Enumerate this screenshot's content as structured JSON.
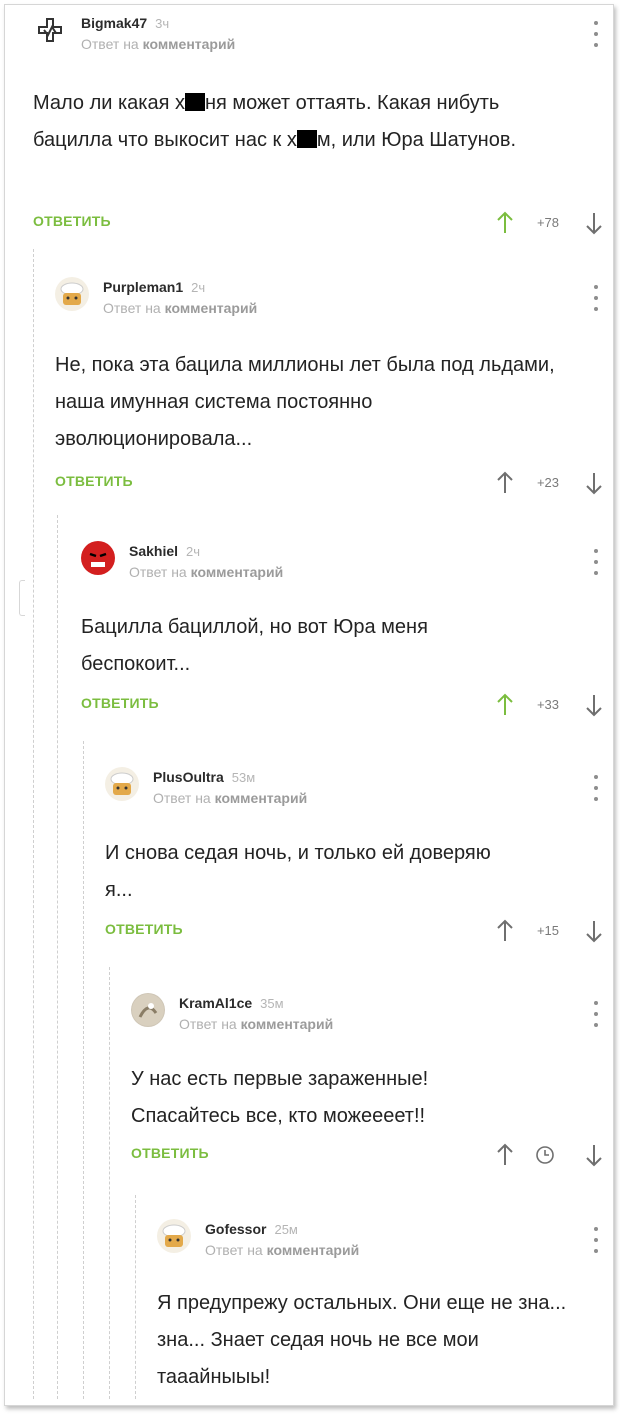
{
  "reply_meta": {
    "prefix": "Ответ на",
    "target": "комментарий"
  },
  "comments": [
    {
      "username": "Bigmak47",
      "time": "3ч",
      "text_parts": [
        "Мало ли какая х",
        "ня может оттаять. Какая нибуть бацилла что выкосит нас к х",
        "м, или Юра Шатунов."
      ],
      "reply_label": "ОТВЕТИТЬ",
      "rating": "+78",
      "up_color": "#7bbd3f"
    },
    {
      "username": "Purpleman1",
      "time": "2ч",
      "text": "Не, пока эта бацила миллионы лет была под льдами, наша имунная система постоянно эволюционировала...",
      "reply_label": "ОТВЕТИТЬ",
      "rating": "+23",
      "up_color": "#6f6f6f"
    },
    {
      "username": "Sakhiel",
      "time": "2ч",
      "text": "Бацилла бациллой, но вот Юра меня беспокоит...",
      "reply_label": "ОТВЕТИТЬ",
      "rating": "+33",
      "up_color": "#7bbd3f"
    },
    {
      "username": "PlusOultra",
      "time": "53м",
      "text": "И снова седая ночь, и только ей доверяю я...",
      "reply_label": "ОТВЕТИТЬ",
      "rating": "+15",
      "up_color": "#6f6f6f"
    },
    {
      "username": "KramAl1ce",
      "time": "35м",
      "text": "У нас есть первые зараженные! Спасайтесь все, кто можеееет!!",
      "reply_label": "ОТВЕТИТЬ",
      "rating": "clock-icon",
      "up_color": "#6f6f6f"
    },
    {
      "username": "Gofessor",
      "time": "25м",
      "text": "Я предупрежу остальных. Они еще не зна... зна... Знает седая ночь не все мои тааайныыы!"
    }
  ],
  "icons": {
    "up": "arrow-up-icon",
    "down": "arrow-down-icon",
    "menu": "more-vertical-icon",
    "clock": "clock-icon",
    "logo_avatar": "rammstein-logo-icon",
    "default_avatar": "chef-avatar-icon",
    "devil_avatar": "devil-avatar-icon",
    "cat_avatar": "cat-avatar-icon"
  },
  "colors": {
    "accent": "#7bbd3f",
    "text": "#232323",
    "muted": "#b0b0b0"
  }
}
